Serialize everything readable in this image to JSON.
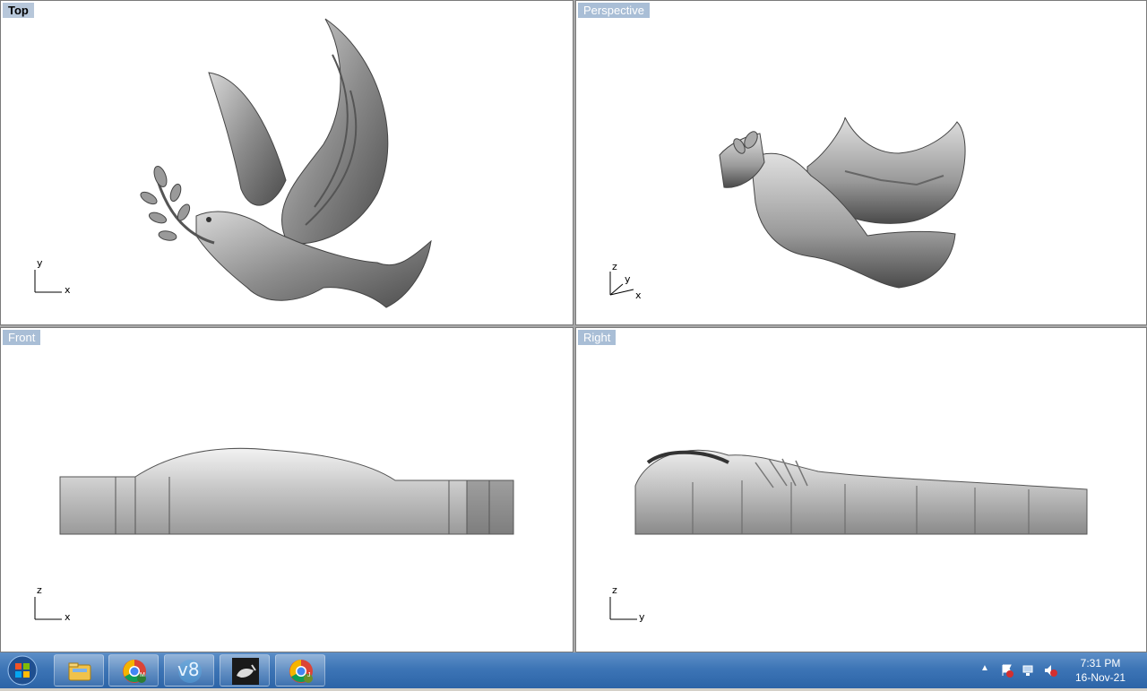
{
  "viewports": [
    {
      "id": "top",
      "title": "Top",
      "active": true,
      "axes": [
        "y",
        "x"
      ]
    },
    {
      "id": "perspective",
      "title": "Perspective",
      "active": false,
      "axes": [
        "z",
        "y",
        "x"
      ]
    },
    {
      "id": "front",
      "title": "Front",
      "active": false,
      "axes": [
        "z",
        "x"
      ]
    },
    {
      "id": "right",
      "title": "Right",
      "active": false,
      "axes": [
        "z",
        "y"
      ]
    }
  ],
  "taskbar": {
    "buttons": [
      {
        "name": "windows-explorer-button",
        "icon": "folder-icon"
      },
      {
        "name": "chrome-profile-m-button",
        "icon": "chrome-icon",
        "badge": "M"
      },
      {
        "name": "v8-app-button",
        "icon": "v8-icon",
        "badge": "v8"
      },
      {
        "name": "rhino-button",
        "icon": "rhino-icon"
      },
      {
        "name": "chrome-profile-j-button",
        "icon": "chrome-icon",
        "badge": "J"
      }
    ],
    "clock": {
      "time": "7:31 PM",
      "date": "16-Nov-21"
    },
    "colors": {
      "accent": "#2c64a7"
    }
  }
}
